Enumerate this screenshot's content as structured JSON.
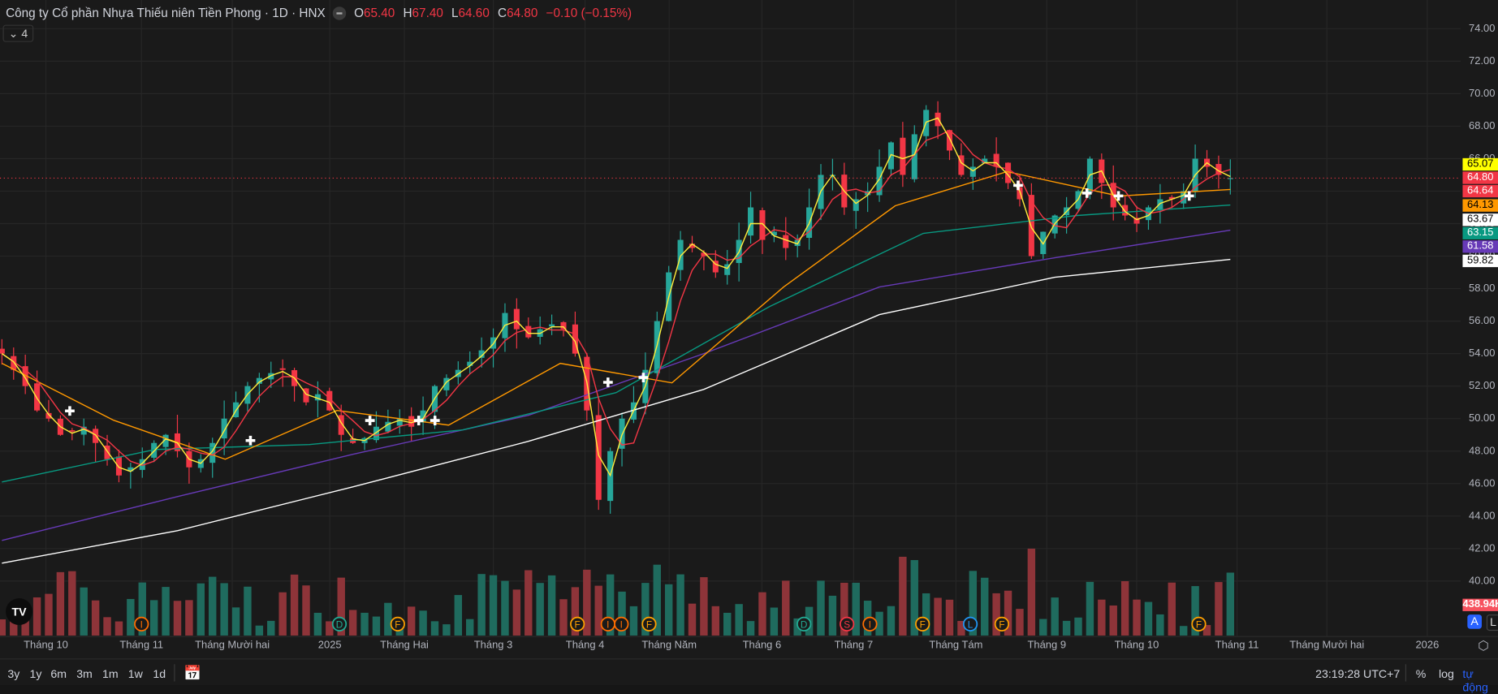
{
  "header": {
    "title": "Công ty Cổ phần Nhựa Thiếu niên Tiền Phong · 1D · HNX",
    "ohlc": {
      "o_label": "O",
      "o": "65.40",
      "h_label": "H",
      "h": "67.40",
      "l_label": "L",
      "l": "64.60",
      "c_label": "C",
      "c": "64.80",
      "change": "−0.10 (−0.15%)"
    },
    "indicators_collapsed": "4"
  },
  "colors": {
    "up": "#26a69a",
    "down": "#f23645",
    "ma_yellow": "#ffeb3b",
    "ma_red": "#f23645",
    "ma_orange": "#ff9800",
    "ma_teal": "#089981",
    "ma_purple": "#673ab7",
    "ma_white": "#ffffff",
    "accent": "#2962ff"
  },
  "chart_data": {
    "type": "candlestick",
    "y_ticks": [
      "74.00",
      "72.00",
      "70.00",
      "68.00",
      "66.00",
      "64.00",
      "62.00",
      "60.00",
      "58.00",
      "56.00",
      "54.00",
      "52.00",
      "50.00",
      "48.00",
      "46.00",
      "44.00",
      "42.00",
      "40.00"
    ],
    "ylim": [
      39,
      75
    ],
    "x_ticks": [
      "Tháng 10",
      "Tháng 11",
      "Tháng Mười hai",
      "2025",
      "Tháng Hai",
      "Tháng 3",
      "Tháng 4",
      "Tháng Năm",
      "Tháng 6",
      "Tháng 7",
      "Tháng Tám",
      "Tháng 9",
      "Tháng 10",
      "Tháng 11",
      "Tháng Mười hai",
      "2026"
    ],
    "closes": [
      54,
      53,
      52,
      50.5,
      50,
      49,
      49.2,
      49.5,
      48.5,
      47.5,
      46.5,
      47,
      47.5,
      48.5,
      49,
      48,
      47,
      47.5,
      48.5,
      50,
      51,
      52,
      52.5,
      52.8,
      53,
      52,
      51,
      51.5,
      50.5,
      49,
      48.5,
      48.8,
      49.5,
      49.8,
      50,
      49.5,
      50.5,
      52,
      52.5,
      53,
      53.5,
      54.2,
      55,
      56.5,
      55.5,
      55,
      55.5,
      55.8,
      55.5,
      54,
      50.5,
      45,
      48,
      50,
      51,
      53,
      56,
      59,
      61,
      60.5,
      60,
      59,
      59.5,
      61,
      63,
      61,
      61.5,
      60.5,
      61,
      63,
      65,
      65,
      63,
      63.5,
      64,
      65.5,
      67,
      65,
      67.5,
      69,
      68,
      66.5,
      65,
      65.5,
      66,
      65.5,
      64.5,
      63.5,
      60,
      61.5,
      62.5,
      63,
      64,
      66,
      64.5,
      63,
      62.5,
      62,
      63,
      63.5,
      63.5,
      64,
      66,
      65.5,
      65,
      64.8
    ],
    "moving_averages": [
      {
        "color": "#ffffff",
        "label": "59.82",
        "values": [
          41.1,
          43.1,
          45.8,
          48.6,
          51.8,
          56.4,
          58.7,
          59.8
        ]
      },
      {
        "color": "#673ab7",
        "label": "61.58",
        "values": [
          42.5,
          45.2,
          47.8,
          50.2,
          54.0,
          58.1,
          59.9,
          61.6
        ]
      },
      {
        "color": "#089981",
        "label": "63.15",
        "values": [
          46.1,
          48.1,
          48.4,
          49.3,
          51.6,
          56.9,
          61.4,
          62.5,
          63.15
        ]
      },
      {
        "color": "#ff9800",
        "label": "64.13",
        "values": [
          53.4,
          49.9,
          47.5,
          50.5,
          49.6,
          53.4,
          52.2,
          58.1,
          63.1,
          65.2,
          63.7,
          64.1
        ]
      }
    ],
    "price_labels": [
      {
        "value": "65.07",
        "bg": "#ffff00",
        "fg": "#000"
      },
      {
        "value": "64.80",
        "bg": "#f23645",
        "fg": "#fff"
      },
      {
        "value": "64.64",
        "bg": "#f23645",
        "fg": "#fff"
      },
      {
        "value": "64.13",
        "bg": "#ff9800",
        "fg": "#000"
      },
      {
        "value": "63.67",
        "bg": "#ffffff",
        "fg": "#000"
      },
      {
        "value": "63.15",
        "bg": "#089981",
        "fg": "#fff"
      },
      {
        "value": "61.58",
        "bg": "#673ab7",
        "fg": "#fff"
      },
      {
        "value": "59.82",
        "bg": "#ffffff",
        "fg": "#000"
      }
    ],
    "volume_label": "438.94K",
    "events": [
      "I",
      "D",
      "F",
      "F",
      "I",
      "I",
      "F",
      "D",
      "S",
      "I",
      "F",
      "L",
      "F",
      "F"
    ]
  },
  "toolbar": {
    "ranges": [
      "3y",
      "1y",
      "6m",
      "3m",
      "1m",
      "1w",
      "1d"
    ],
    "time": "23:19:28 UTC+7",
    "percent": "%",
    "log": "log",
    "auto": "tự động",
    "a_btn": "A",
    "l_btn": "L"
  },
  "logo": "TV"
}
